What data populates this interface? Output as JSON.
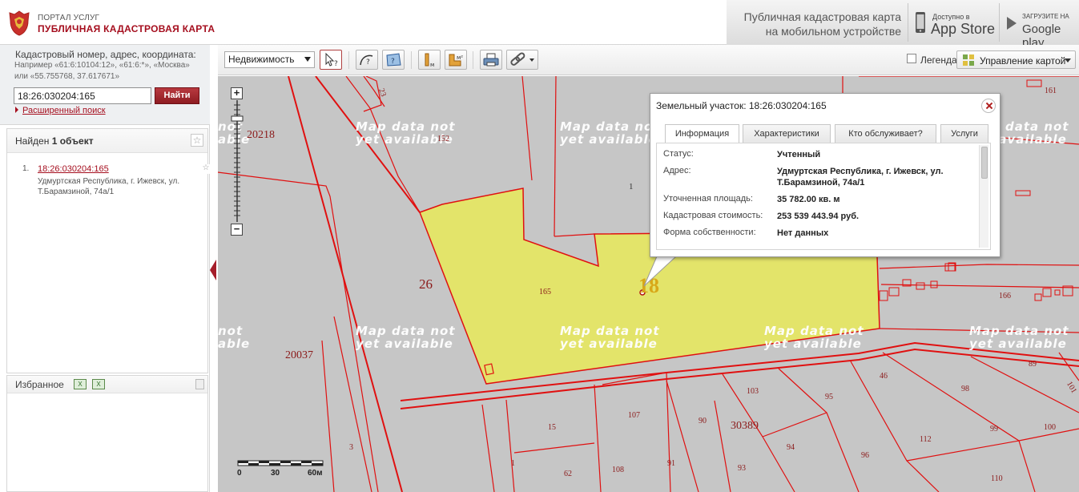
{
  "header": {
    "portal_small": "ПОРТАЛ УСЛУГ",
    "portal_title": "ПУБЛИЧНАЯ КАДАСТРОВАЯ КАРТА",
    "mobile_line1": "Публичная кадастровая карта",
    "mobile_line2": "на мобильном устройстве",
    "appstore_small": "Доступно в",
    "appstore_big": "App Store",
    "googleplay_small": "ЗАГРУЗИТЕ НА",
    "googleplay_big": "Google play"
  },
  "search": {
    "label": "Кадастровый номер, адрес, координата:",
    "example": "Например «61:6:10104:12», «61:6:*», «Москва» или «55.755768, 37.617671»",
    "value": "18:26:030204:165",
    "button": "Найти",
    "advanced": "Расширенный поиск"
  },
  "results": {
    "found_prefix": "Найден",
    "found_count": "1 объект",
    "items": [
      {
        "num": "1.",
        "link": "18:26:030204:165",
        "address": "Удмуртская Республика, г. Ижевск, ул. Т.Барамзиной, 74а/1"
      }
    ]
  },
  "favorites": {
    "title": "Избранное"
  },
  "toolbar": {
    "layer_select": "Недвижимость",
    "legend_label": "Легенда",
    "map_management": "Управление картой"
  },
  "map": {
    "nodata_text": "Map data not\nyet available",
    "nodata_text_cut": "not\nable",
    "nodata_text_cut2": "Map data not\nyet availa",
    "plots": {
      "p20218": "20218",
      "p23": "23",
      "p152": "152",
      "p1": "1",
      "p161": "161",
      "p26": "26",
      "p165": "165",
      "p18": "18",
      "p166": "166",
      "p20037": "20037",
      "p89": "89",
      "p46": "46",
      "p98": "98",
      "p101": "101",
      "p103": "103",
      "p95": "95",
      "p107": "107",
      "p90": "90",
      "p30389": "30389",
      "p99": "99",
      "p100": "100",
      "p15": "15",
      "p112": "112",
      "p94": "94",
      "p96": "96",
      "p3": "3",
      "p1b": "1",
      "p62": "62",
      "p108": "108",
      "p91": "91",
      "p93": "93",
      "p110": "110"
    },
    "scale": {
      "l0": "0",
      "l30": "30",
      "l60": "60м"
    }
  },
  "popup": {
    "title": "Земельный участок: 18:26:030204:165",
    "tabs": [
      "Информация",
      "Характеристики",
      "Кто обслуживает?",
      "Услуги"
    ],
    "rows": [
      {
        "label": "Статус:",
        "value": "Учтенный"
      },
      {
        "label": "Адрес:",
        "value": "Удмуртская Республика, г. Ижевск, ул. Т.Барамзиной, 74а/1"
      },
      {
        "label": "Уточненная площадь:",
        "value": "35 782.00 кв. м"
      },
      {
        "label": "Кадастровая стоимость:",
        "value": "253 539 443.94 руб."
      },
      {
        "label": "Форма собственности:",
        "value": "Нет данных"
      }
    ]
  },
  "colors": {
    "brand_red": "#a50e1e",
    "map_bg": "#c6c6c6",
    "parcel_line": "#e01010",
    "selected_fill": "#e3e46a"
  }
}
